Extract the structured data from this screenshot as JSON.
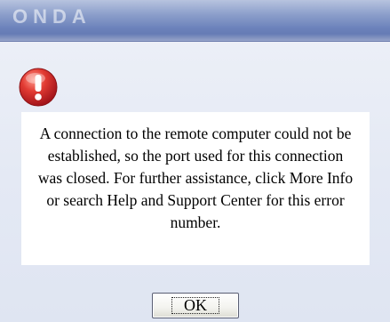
{
  "titlebar": {
    "logo_text": "ONDA"
  },
  "icons": {
    "error": "exclamation-circle-icon"
  },
  "message": {
    "text": "A connection to the remote computer could not be established, so the port used for this connection was closed. For further assistance, click More Info or search Help and Support Center for this error number."
  },
  "buttons": {
    "ok_label": "OK"
  },
  "colors": {
    "titlebar": "#6b81ba",
    "dialog_background": "#e4e9f4",
    "error_icon": "#d42a2a"
  }
}
